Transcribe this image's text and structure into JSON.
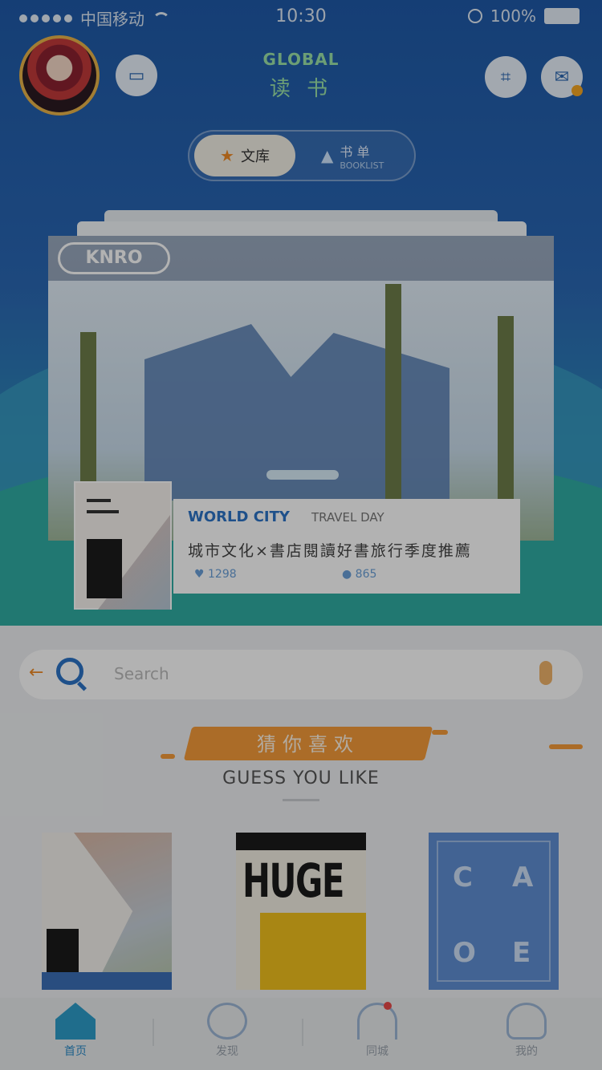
{
  "status_bar": {
    "carrier": "中国移动",
    "time": "10:30",
    "battery": "100%"
  },
  "header": {
    "brand_en": "GLOBAL",
    "brand_cn": "读 书"
  },
  "segment": {
    "active_label": "文库",
    "inactive_label": "书 单",
    "inactive_sub": "BOOKLIST"
  },
  "feature": {
    "logo_text": "KNRO",
    "card_title": "WORLD CITY",
    "card_subtitle": "TRAVEL DAY",
    "card_desc": "城市文化×書店閱讀好書旅行季度推薦",
    "meta_1": "1298",
    "meta_2": "865"
  },
  "search": {
    "placeholder": "Search"
  },
  "section": {
    "title_cn": "猜你喜欢",
    "title_en": "GUESS YOU LIKE"
  },
  "books": [
    {
      "cover_text": ""
    },
    {
      "cover_text": "HUGE"
    },
    {
      "cover_text": ""
    }
  ],
  "tabs": [
    {
      "label": "首页"
    },
    {
      "label": "发现"
    },
    {
      "label": "同城"
    },
    {
      "label": "我的"
    }
  ]
}
